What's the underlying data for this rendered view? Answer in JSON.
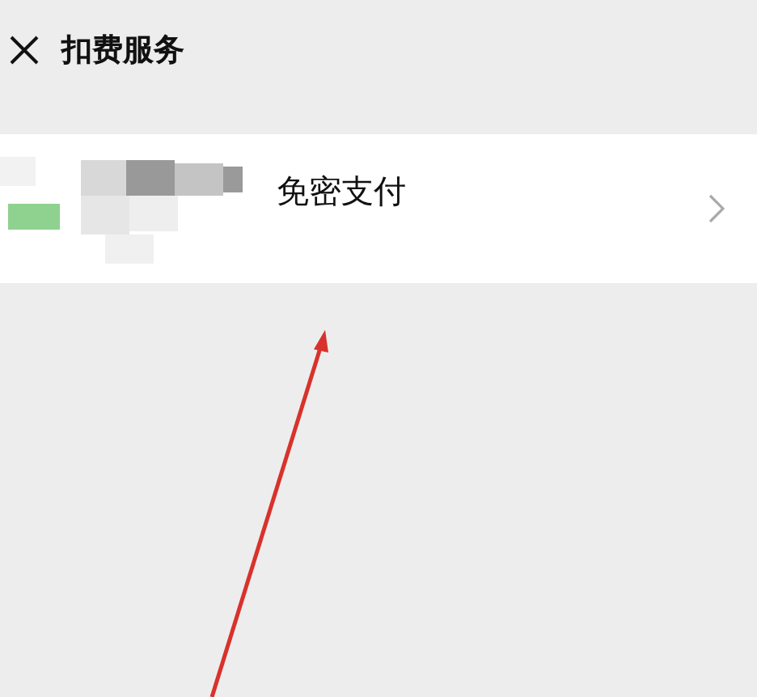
{
  "title": "扣费服务",
  "items": [
    {
      "label": "免密支付"
    }
  ]
}
